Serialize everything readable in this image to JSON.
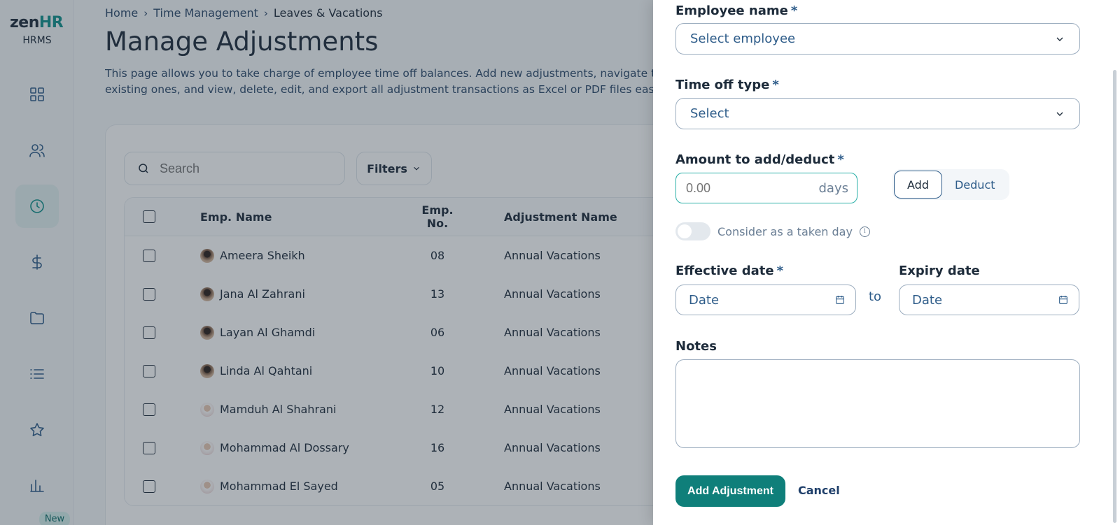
{
  "sidebar": {
    "logo_main": "zen",
    "logo_accent": "HR",
    "logo_sub": "HRMS",
    "new_badge": "New",
    "items": [
      {
        "icon": "dashboard-icon",
        "active": false
      },
      {
        "icon": "people-icon",
        "active": false
      },
      {
        "icon": "clock-icon",
        "active": true
      },
      {
        "icon": "dollar-icon",
        "active": false
      },
      {
        "icon": "folder-icon",
        "active": false
      },
      {
        "icon": "list-icon",
        "active": false
      },
      {
        "icon": "star-icon",
        "active": false
      },
      {
        "icon": "bar-chart-icon",
        "active": false
      }
    ]
  },
  "breadcrumb": {
    "home": "Home",
    "section": "Time Management",
    "current": "Leaves & Vacations"
  },
  "page": {
    "title": "Manage Adjustments",
    "description_line1": "This page allows you to take charge of employee time off balances. Add new adjustments, navigate throug",
    "description_line2": "existing ones, and view, delete, edit, and export all adjustment transactions as Excel or PDF files easily."
  },
  "toolbar": {
    "search_placeholder": "Search",
    "filters_label": "Filters"
  },
  "table": {
    "headers": {
      "name": "Emp. Name",
      "number": "Emp. No.",
      "adjustment": "Adjustment Name"
    },
    "rows": [
      {
        "name": "Ameera Sheikh",
        "number": "08",
        "adjustment": "Annual Vacations"
      },
      {
        "name": "Jana Al Zahrani",
        "number": "13",
        "adjustment": "Annual Vacations"
      },
      {
        "name": "Layan Al Ghamdi",
        "number": "06",
        "adjustment": "Annual Vacations"
      },
      {
        "name": "Linda Al Qahtani",
        "number": "10",
        "adjustment": "Annual Vacations"
      },
      {
        "name": "Mamduh Al Shahrani",
        "number": "12",
        "adjustment": "Annual Vacations"
      },
      {
        "name": "Mohammad Al Dossary",
        "number": "16",
        "adjustment": "Annual Vacations"
      },
      {
        "name": "Mohammad El Sayed",
        "number": "05",
        "adjustment": "Annual Vacations"
      }
    ]
  },
  "drawer": {
    "employee_label": "Employee name",
    "employee_placeholder": "Select employee",
    "timeoff_label": "Time off type",
    "timeoff_placeholder": "Select",
    "amount_label": "Amount to add/deduct",
    "amount_placeholder": "0.00",
    "amount_unit": "days",
    "add_option": "Add",
    "deduct_option": "Deduct",
    "taken_day_label": "Consider as a taken day",
    "effective_label": "Effective date",
    "effective_placeholder": "Date",
    "to_text": "to",
    "expiry_label": "Expiry date",
    "expiry_placeholder": "Date",
    "notes_label": "Notes",
    "submit_label": "Add Adjustment",
    "cancel_label": "Cancel",
    "required_mark": "*"
  },
  "colors": {
    "brand": "#10908c",
    "primary_button": "#0f7f7a",
    "focus_border": "#2bb0a8",
    "overlay": "rgba(40,52,66,0.38)"
  }
}
